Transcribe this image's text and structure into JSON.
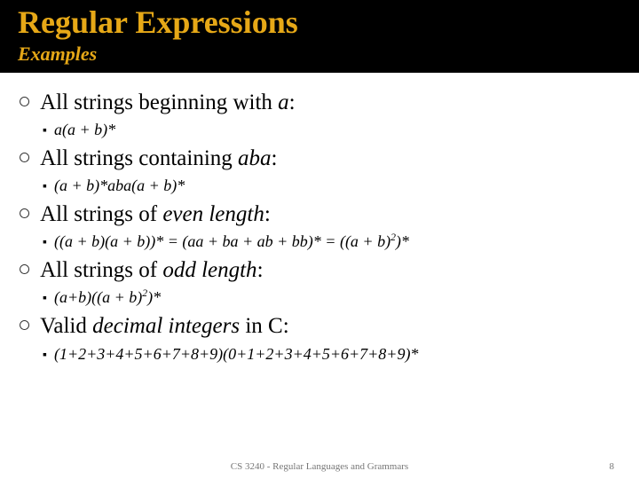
{
  "header": {
    "title": "Regular Expressions",
    "subtitle": "Examples"
  },
  "items": [
    {
      "text_pre": "All strings beginning with ",
      "text_em": "a",
      "text_post": ":",
      "sub_html": "a(a + b)*"
    },
    {
      "text_pre": "All strings containing ",
      "text_em": "aba",
      "text_post": ":",
      "sub_html": "(a + b)*aba(a + b)*"
    },
    {
      "text_pre": "All strings of ",
      "text_em": "even length",
      "text_post": ":",
      "sub_html": "((a + b)(a + b))* = (aa + ba + ab + bb)* = ((a + b)<sup>2</sup>)*"
    },
    {
      "text_pre": "All strings of ",
      "text_em": "odd length",
      "text_post": ":",
      "sub_html": "(a+b)((a + b)<sup>2</sup>)*"
    },
    {
      "text_pre": "Valid ",
      "text_em": "decimal integers",
      "text_post": " in C:",
      "sub_html": "(1+2+3+4+5+6+7+8+9)(0+1+2+3+4+5+6+7+8+9)*"
    }
  ],
  "footer": {
    "center": "CS 3240 - Regular Languages and Grammars",
    "page": "8"
  }
}
